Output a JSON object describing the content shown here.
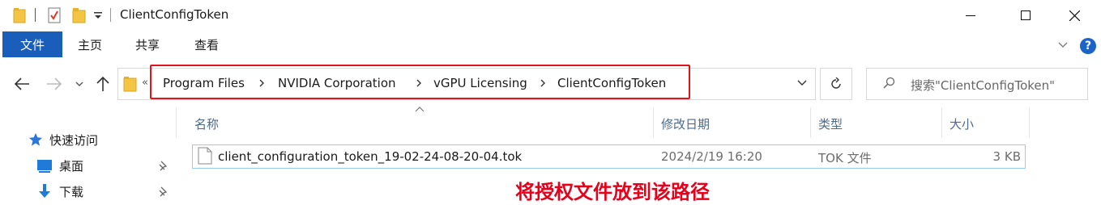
{
  "window": {
    "title": "ClientConfigToken",
    "minimize_glyph": "─",
    "maximize_glyph": "☐",
    "close_glyph": "✕"
  },
  "quick_access_toolbar": {
    "icons": [
      "folder-icon",
      "properties-icon",
      "new-folder-icon",
      "customize-dropdown-icon"
    ]
  },
  "ribbon": {
    "tabs": [
      {
        "label": "文件",
        "active": true
      },
      {
        "label": "主页",
        "active": false
      },
      {
        "label": "共享",
        "active": false
      },
      {
        "label": "查看",
        "active": false
      }
    ],
    "help_label": "?"
  },
  "address_bar": {
    "overflow": "«",
    "breadcrumbs": [
      "Program Files",
      "NVIDIA Corporation",
      "vGPU Licensing",
      "ClientConfigToken"
    ],
    "highlight_color": "#e0141e"
  },
  "search": {
    "placeholder": "搜索\"ClientConfigToken\""
  },
  "nav_pane": {
    "items": [
      {
        "label": "快速访问",
        "icon": "star-icon",
        "pinned": false
      },
      {
        "label": "桌面",
        "icon": "desktop-icon",
        "pinned": true
      },
      {
        "label": "下载",
        "icon": "download-icon",
        "pinned": true
      }
    ]
  },
  "file_list": {
    "columns": [
      "名称",
      "修改日期",
      "类型",
      "大小"
    ],
    "sort_indicator": "^",
    "rows": [
      {
        "name": "client_configuration_token_19-02-24-08-20-04.tok",
        "modified": "2024/2/19 16:20",
        "type": "TOK 文件",
        "size": "3 KB"
      }
    ]
  },
  "annotation": {
    "text": "将授权文件放到该路径",
    "color": "#e8001a"
  },
  "colors": {
    "file_tab_bg": "#1a5ebb",
    "selection_border": "#99c9ef",
    "column_header_text": "#4d6a8a"
  }
}
